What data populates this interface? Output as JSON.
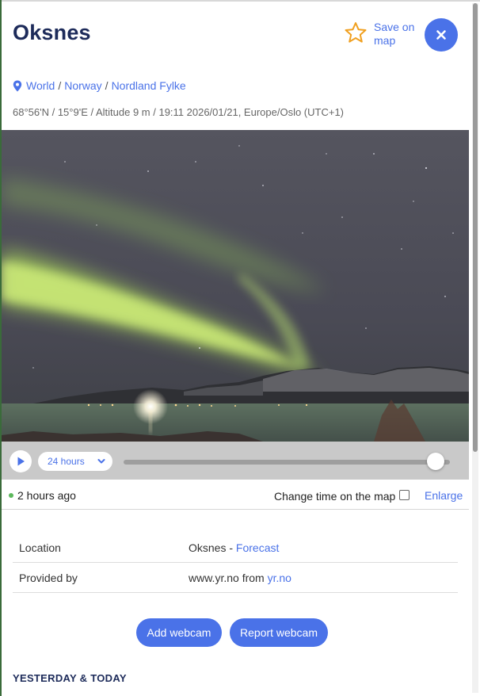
{
  "header": {
    "title": "Oksnes",
    "save_label": "Save on map",
    "close_icon": "close-icon",
    "star_icon": "star-icon",
    "accent": "#4a72e8",
    "star_color": "#f0a020"
  },
  "breadcrumb": {
    "items": [
      "World",
      "Norway",
      "Nordland Fylke"
    ],
    "separator": "/"
  },
  "meta": {
    "text": "68°56'N / 15°9'E / Altitude 9 m / 19:11 2026/01/21, Europe/Oslo (UTC+1)"
  },
  "player": {
    "range_label": "24 hours",
    "slider_value": 0.96
  },
  "status": {
    "time_ago": "2 hours ago",
    "change_time_label": "Change time on the map",
    "change_time_checked": false,
    "enlarge_label": "Enlarge",
    "online_color": "#5cb85c"
  },
  "info": {
    "location_key": "Location",
    "location_value": "Oksnes",
    "location_dash": " - ",
    "location_link": "Forecast",
    "provided_key": "Provided by",
    "provided_value": "www.yr.no from ",
    "provided_link": "yr.no"
  },
  "actions": {
    "add_label": "Add webcam",
    "report_label": "Report webcam"
  },
  "section": {
    "heading": "YESTERDAY & TODAY"
  }
}
